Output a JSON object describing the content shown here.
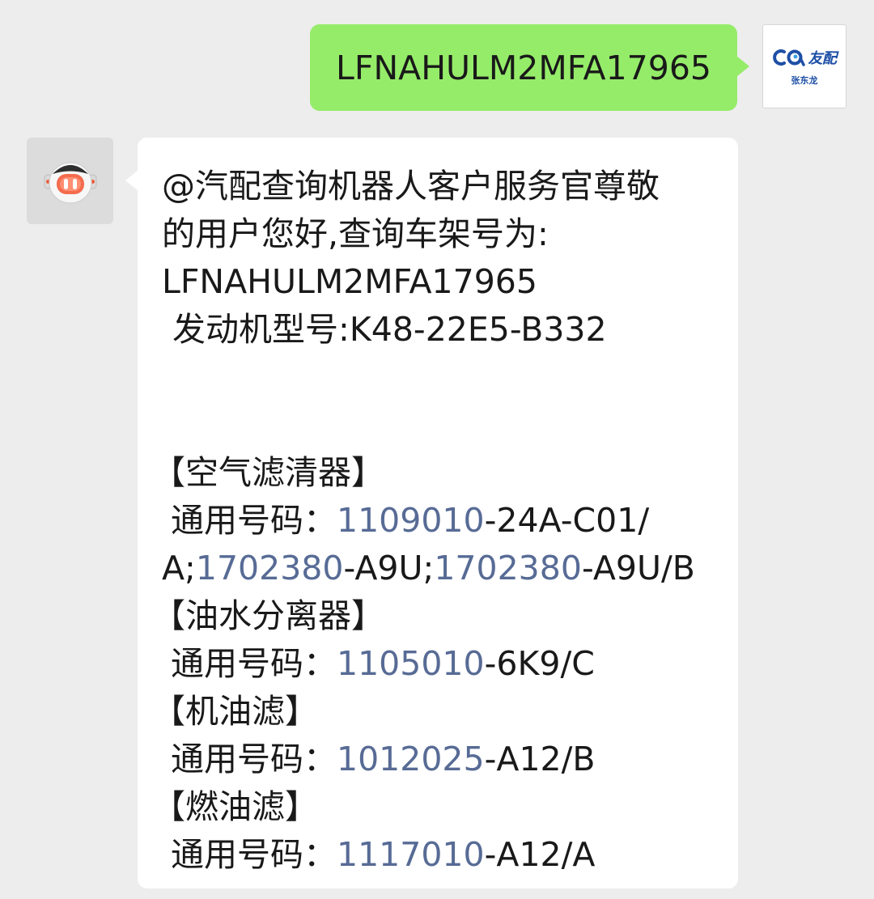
{
  "sent_message": {
    "text": "LFNAHULM2MFA17965",
    "avatar": {
      "logo_text": "友配",
      "name": "张东龙"
    }
  },
  "received_message": {
    "avatar_icon": "robot-icon",
    "greeting_1": "@汽配查询机器人客户服务官尊敬",
    "greeting_2": "的用户您好,查询车架号为:",
    "vin": "LFNAHULM2MFA17965",
    "engine": " 发动机型号:K48-22E5-B332",
    "parts": {
      "air_filter": {
        "title": "【空气滤清器】",
        "code_label": "通用号码：",
        "code1_link": "1109010",
        "code1_rest": "-24A-C01/",
        "code1_cont": "A;",
        "code2_link": "1702380",
        "code2_rest": "-A9U;",
        "code3_link": "1702380",
        "code3_rest": "-A9U/B"
      },
      "oil_water_separator": {
        "title": "【油水分离器】",
        "code_label": "通用号码：",
        "code_link": "1105010",
        "code_rest": "-6K9/C"
      },
      "oil_filter": {
        "title": "【机油滤】",
        "code_label": "通用号码：",
        "code_link": "1012025",
        "code_rest": "-A12/B"
      },
      "fuel_filter": {
        "title": "【燃油滤】",
        "code_label": "通用号码：",
        "code_link": "1117010",
        "code_rest": "-A12/A"
      }
    }
  },
  "colors": {
    "background": "#ededed",
    "bubble_sent": "#95ec69",
    "bubble_received": "#ffffff",
    "link": "#576b95"
  }
}
